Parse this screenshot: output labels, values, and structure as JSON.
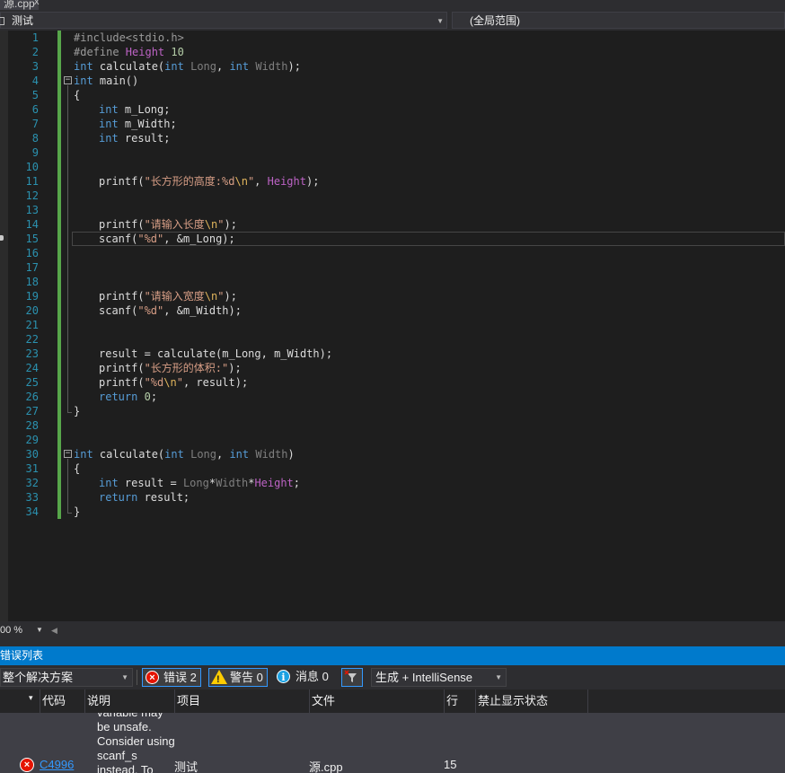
{
  "tab": {
    "filename": "源.cpp",
    "close": "x"
  },
  "navbar": {
    "project": "测试",
    "scope": "(全局范围)"
  },
  "editor": {
    "line_numbers": [
      "1",
      "2",
      "3",
      "4",
      "5",
      "6",
      "7",
      "8",
      "9",
      "10",
      "11",
      "12",
      "13",
      "14",
      "15",
      "16",
      "17",
      "18",
      "19",
      "20",
      "21",
      "22",
      "23",
      "24",
      "25",
      "26",
      "27",
      "28",
      "29",
      "30",
      "31",
      "32",
      "33",
      "34"
    ],
    "lines": {
      "l1": "#include<stdio.h>",
      "l2a": "#define ",
      "l2b": "Height",
      "l2c": " 10",
      "l3a": "int",
      "l3b": " calculate(",
      "l3c": "int",
      "l3d": " ",
      "l3e": "Long",
      "l3f": ", ",
      "l3g": "int",
      "l3h": " ",
      "l3i": "Width",
      "l3j": ");",
      "l4a": "int",
      "l4b": " main()",
      "l5": "{",
      "l6a": "int",
      "l6b": " m_Long;",
      "l7a": "int",
      "l7b": " m_Width;",
      "l8a": "int",
      "l8b": " result;",
      "l11a": "printf(",
      "l11b": "\"长方形的高度:%d",
      "l11c": "\\n",
      "l11d": "\"",
      "l11e": ", ",
      "l11f": "Height",
      "l11g": ");",
      "l14a": "printf(",
      "l14b": "\"请输入长度",
      "l14c": "\\n",
      "l14d": "\"",
      "l14e": ");",
      "l15a": "scanf(",
      "l15b": "\"%d\"",
      "l15c": ", &m_Long);",
      "l19a": "printf(",
      "l19b": "\"请输入宽度",
      "l19c": "\\n",
      "l19d": "\"",
      "l19e": ");",
      "l20a": "scanf(",
      "l20b": "\"%d\"",
      "l20c": ", &m_Width);",
      "l23": "result = calculate(m_Long, m_Width);",
      "l24a": "printf(",
      "l24b": "\"长方形的体积:\"",
      "l24c": ");",
      "l25a": "printf(",
      "l25b": "\"%d",
      "l25c": "\\n",
      "l25d": "\"",
      "l25e": ", result);",
      "l26a": "return",
      "l26b": " ",
      "l26c": "0",
      "l26d": ";",
      "l27": "}",
      "l30a": "int",
      "l30b": " calculate(",
      "l30c": "int",
      "l30d": " ",
      "l30e": "Long",
      "l30f": ", ",
      "l30g": "int",
      "l30h": " ",
      "l30i": "Width",
      "l30j": ")",
      "l31": "{",
      "l32a": "int",
      "l32b": " result = ",
      "l32c": "Long",
      "l32d": "*",
      "l32e": "Width",
      "l32f": "*",
      "l32g": "Height",
      "l32h": ";",
      "l33a": "return",
      "l33b": " result;",
      "l34": "}"
    },
    "fold_minus": "−"
  },
  "zoom": {
    "value": "00 %",
    "drop": "▼",
    "left": "◀"
  },
  "error_list": {
    "title": "错误列表",
    "scope": "整个解决方案",
    "errors_label": "错误 2",
    "warnings_label": "警告 0",
    "messages_label": "消息 0",
    "build_filter": "生成 + IntelliSense",
    "columns": [
      "代码",
      "说明",
      "项目",
      "文件",
      "行",
      "禁止显示状态"
    ],
    "row": {
      "code": "C4996",
      "description": "variable may be unsafe. Consider using scanf_s instead. To disable",
      "project": "测试",
      "file": "源.cpp",
      "line": "15"
    },
    "icons": {
      "error": "×",
      "warning": "!",
      "info": "i"
    }
  }
}
